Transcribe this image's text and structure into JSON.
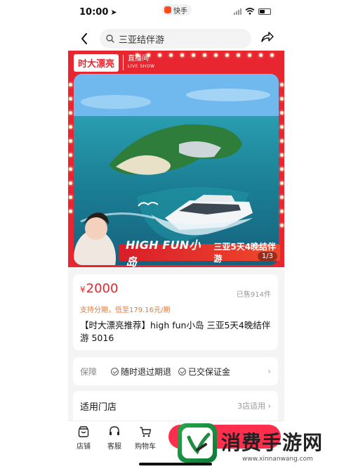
{
  "status": {
    "time": "10:00",
    "app_label": "快手"
  },
  "nav": {
    "search_text": "三亚结伴游"
  },
  "hero": {
    "logo_brand": "时大漂亮",
    "logo_live": "直播间",
    "logo_live_en": "LIVE SHOW",
    "title": "HIGH FUN小岛",
    "subtitle": "三亚5天4晚结伴游",
    "page_indicator": "1/3",
    "frame_color": "#e8262f"
  },
  "product": {
    "currency": "¥",
    "price": "2000",
    "sold": "已售914件",
    "installment": "支持分期，低至179.16元/期",
    "title": "【时大漂亮推荐】high fun小岛 三亚5天4晚结伴游 5016"
  },
  "guarantee": {
    "label": "保障",
    "items": [
      "随时退过期退",
      "已交保证金"
    ]
  },
  "stores": {
    "label": "适用门店",
    "count": "3店适用"
  },
  "bottom": {
    "tabs": [
      {
        "label": "店铺",
        "icon": "store-icon"
      },
      {
        "label": "客服",
        "icon": "headset-icon"
      },
      {
        "label": "购物车",
        "icon": "cart-icon"
      }
    ],
    "buy_color": "#ff2e4d"
  },
  "watermark": {
    "text": "消费手游网",
    "url": "www.xinnanwang.com"
  }
}
